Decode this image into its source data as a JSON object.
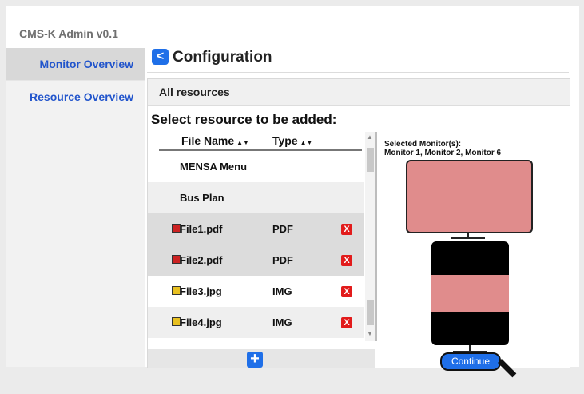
{
  "app_title": "CMS-K Admin v0.1",
  "sidebar": {
    "items": [
      {
        "label": "Monitor Overview",
        "active": true
      },
      {
        "label": "Resource Overview",
        "active": false
      }
    ]
  },
  "header": {
    "back_icon": "chevron-left-icon",
    "back_glyph": "<",
    "title": "Configuration"
  },
  "panel": {
    "heading": "All resources",
    "select_label": "Select resource to be added:",
    "columns": {
      "file_name": "File Name",
      "type": "Type"
    },
    "sort_glyph": "▲▼",
    "rows": [
      {
        "name": "MENSA Menu",
        "type": "",
        "icon_color": "",
        "deletable": false
      },
      {
        "name": "Bus Plan",
        "type": "",
        "icon_color": "",
        "deletable": false
      },
      {
        "name": "File1.pdf",
        "type": "PDF",
        "icon_color": "#cc2222",
        "deletable": true
      },
      {
        "name": "File2.pdf",
        "type": "PDF",
        "icon_color": "#cc2222",
        "deletable": true
      },
      {
        "name": "File3.jpg",
        "type": "IMG",
        "icon_color": "#e8c020",
        "deletable": true
      },
      {
        "name": "File4.jpg",
        "type": "IMG",
        "icon_color": "#e8c020",
        "deletable": true
      }
    ],
    "delete_glyph": "X",
    "add_glyph": "+",
    "scroll_up_glyph": "▲",
    "scroll_down_glyph": "▼"
  },
  "monitor": {
    "selected_label": "Selected Monitor(s):",
    "selected_list": "Monitor 1, Monitor 2, Monitor 6",
    "continue_label": "Continue"
  },
  "colors": {
    "accent": "#1f6fe8",
    "delete": "#e21b1b",
    "monitor_fill": "#e08c8c"
  }
}
